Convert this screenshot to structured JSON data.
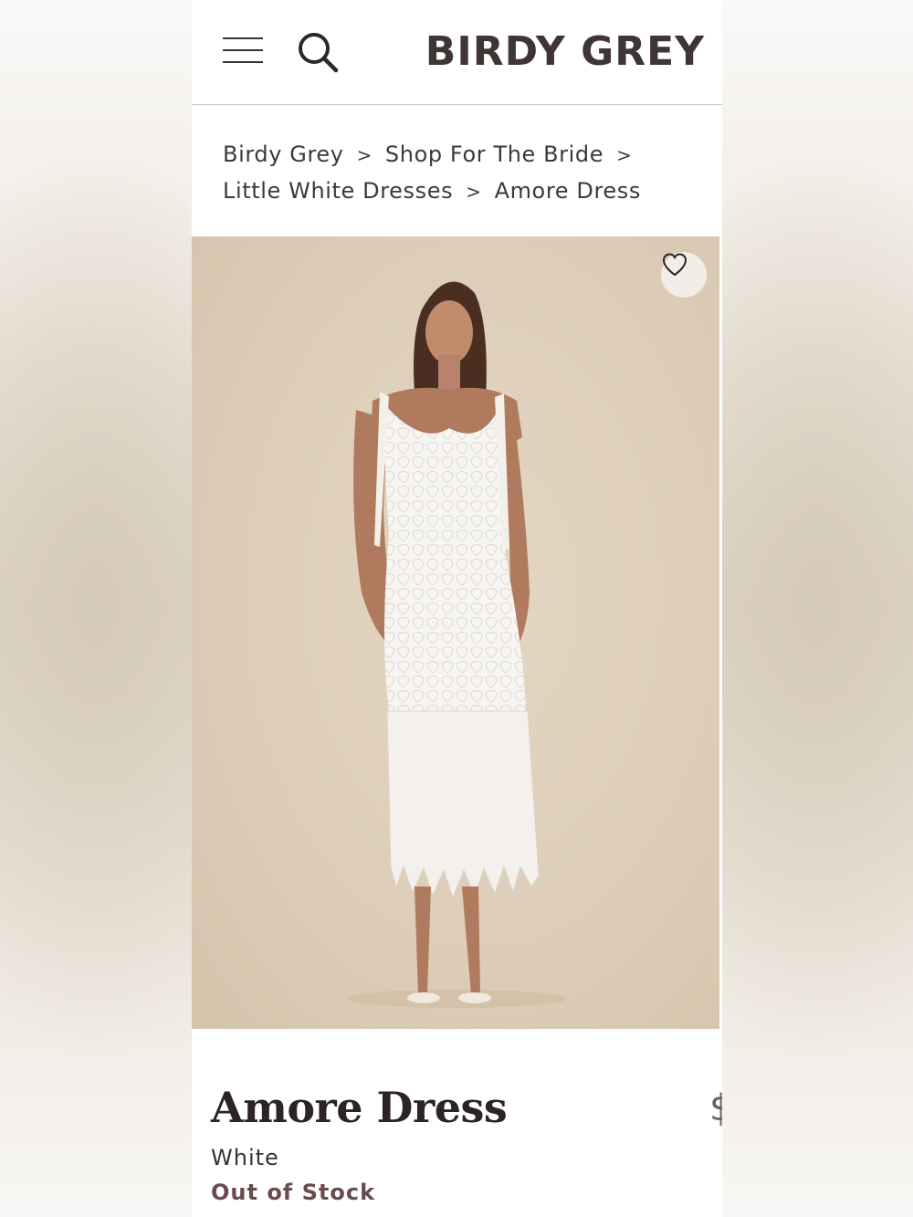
{
  "header": {
    "logo": "BIRDY GREY",
    "menu_icon": "hamburger-menu-icon",
    "search_icon": "search-icon"
  },
  "breadcrumb": {
    "items": [
      "Birdy Grey",
      "Shop For The Bride",
      "Little White Dresses",
      "Amore Dress"
    ],
    "separator": ">"
  },
  "product": {
    "image_alt": "Model wearing white lace midi dress with heart-shaped petal fringe hem",
    "favorite_icon": "heart-outline-icon",
    "title": "Amore Dress",
    "color": "White",
    "stock_status": "Out of Stock",
    "partial_price_glyph": "$"
  },
  "colors": {
    "text": "#3d3434",
    "stock_status": "#6b4a4f",
    "hero_background": "#ddcdb7"
  }
}
